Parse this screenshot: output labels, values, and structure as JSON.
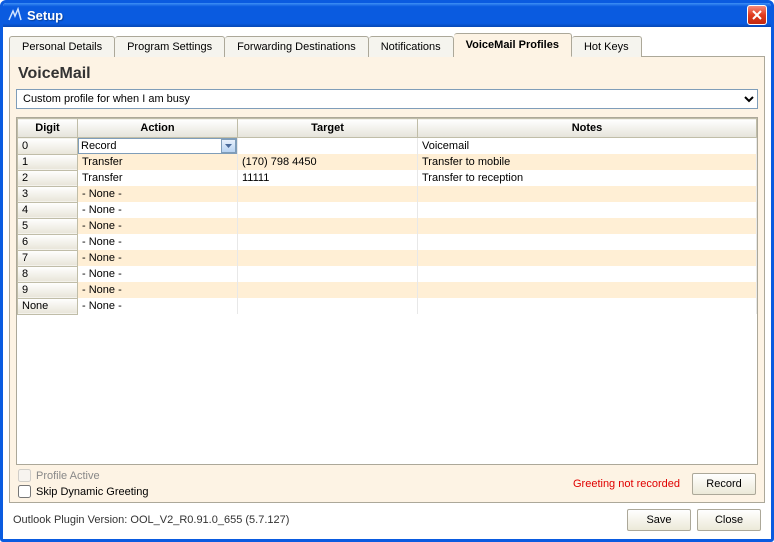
{
  "window": {
    "title": "Setup"
  },
  "tabs": [
    {
      "label": "Personal Details"
    },
    {
      "label": "Program Settings"
    },
    {
      "label": "Forwarding Destinations"
    },
    {
      "label": "Notifications"
    },
    {
      "label": "VoiceMail Profiles"
    },
    {
      "label": "Hot Keys"
    }
  ],
  "active_tab_index": 4,
  "section_title": "VoiceMail",
  "profile_selected": "Custom profile for when I am busy",
  "columns": {
    "digit": "Digit",
    "action": "Action",
    "target": "Target",
    "notes": "Notes"
  },
  "rows": [
    {
      "digit": "0",
      "action": "Record",
      "target": "",
      "notes": "Voicemail",
      "combo": true
    },
    {
      "digit": "1",
      "action": "Transfer",
      "target": "(170) 798 4450",
      "notes": "Transfer to mobile",
      "combo": false
    },
    {
      "digit": "2",
      "action": "Transfer",
      "target": "11111",
      "notes": "Transfer to reception",
      "combo": false
    },
    {
      "digit": "3",
      "action": "- None -",
      "target": "",
      "notes": "",
      "combo": false
    },
    {
      "digit": "4",
      "action": "- None -",
      "target": "",
      "notes": "",
      "combo": false
    },
    {
      "digit": "5",
      "action": "- None -",
      "target": "",
      "notes": "",
      "combo": false
    },
    {
      "digit": "6",
      "action": "- None -",
      "target": "",
      "notes": "",
      "combo": false
    },
    {
      "digit": "7",
      "action": "- None -",
      "target": "",
      "notes": "",
      "combo": false
    },
    {
      "digit": "8",
      "action": "- None -",
      "target": "",
      "notes": "",
      "combo": false
    },
    {
      "digit": "9",
      "action": "- None -",
      "target": "",
      "notes": "",
      "combo": false
    },
    {
      "digit": "None",
      "action": "- None -",
      "target": "",
      "notes": "",
      "combo": false
    }
  ],
  "checkboxes": {
    "profile_active_label": "Profile Active",
    "profile_active_checked": false,
    "profile_active_enabled": false,
    "skip_dynamic_label": "Skip Dynamic Greeting",
    "skip_dynamic_checked": false
  },
  "warning_text": "Greeting not recorded",
  "buttons": {
    "record": "Record",
    "save": "Save",
    "close": "Close"
  },
  "footer_text": "Outlook Plugin Version: OOL_V2_R0.91.0_655 (5.7.127)"
}
